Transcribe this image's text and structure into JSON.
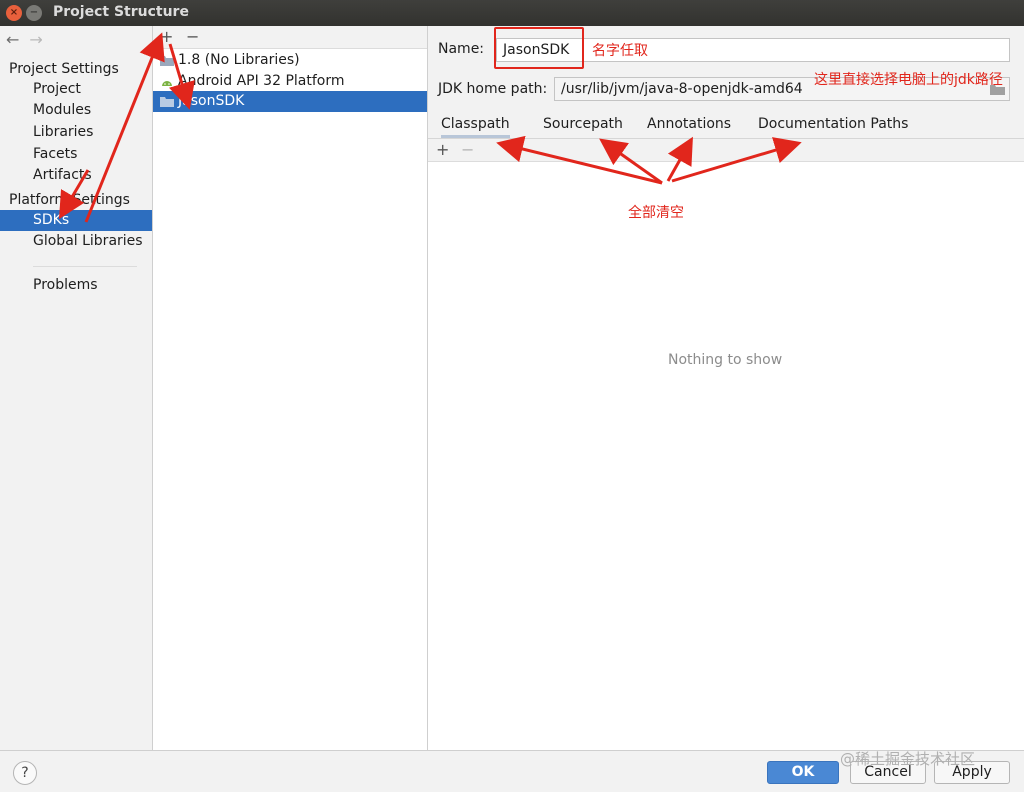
{
  "window": {
    "title": "Project Structure"
  },
  "sidebar": {
    "project_settings_header": "Project Settings",
    "items_project": [
      "Project",
      "Modules",
      "Libraries",
      "Facets",
      "Artifacts"
    ],
    "platform_settings_header": "Platform Settings",
    "items_platform": [
      "SDKs",
      "Global Libraries"
    ],
    "problems": "Problems",
    "selected": "SDKs"
  },
  "sdk_list": {
    "add": "+",
    "remove": "−",
    "items": [
      {
        "label": "1.8 (No Libraries)",
        "icon": "folder-icon"
      },
      {
        "label": "Android API 32 Platform",
        "icon": "android-icon"
      },
      {
        "label": "JasonSDK",
        "icon": "folder-icon",
        "selected": true
      }
    ]
  },
  "details": {
    "name_label": "Name:",
    "name_value": "JasonSDK",
    "home_label": "JDK home path:",
    "home_value": "/usr/lib/jvm/java-8-openjdk-amd64",
    "tabs": [
      "Classpath",
      "Sourcepath",
      "Annotations",
      "Documentation Paths"
    ],
    "active_tab": "Classpath",
    "cp_add": "+",
    "cp_remove": "−",
    "empty_text": "Nothing to show"
  },
  "annotations": {
    "name_note": "名字任取",
    "path_note": "这里直接选择电脑上的jdk路径",
    "clear_note": "全部清空",
    "color": "#e1261c"
  },
  "footer": {
    "help": "?",
    "ok": "OK",
    "cancel": "Cancel",
    "apply": "Apply"
  },
  "watermark": "@稀土掘金技术社区"
}
